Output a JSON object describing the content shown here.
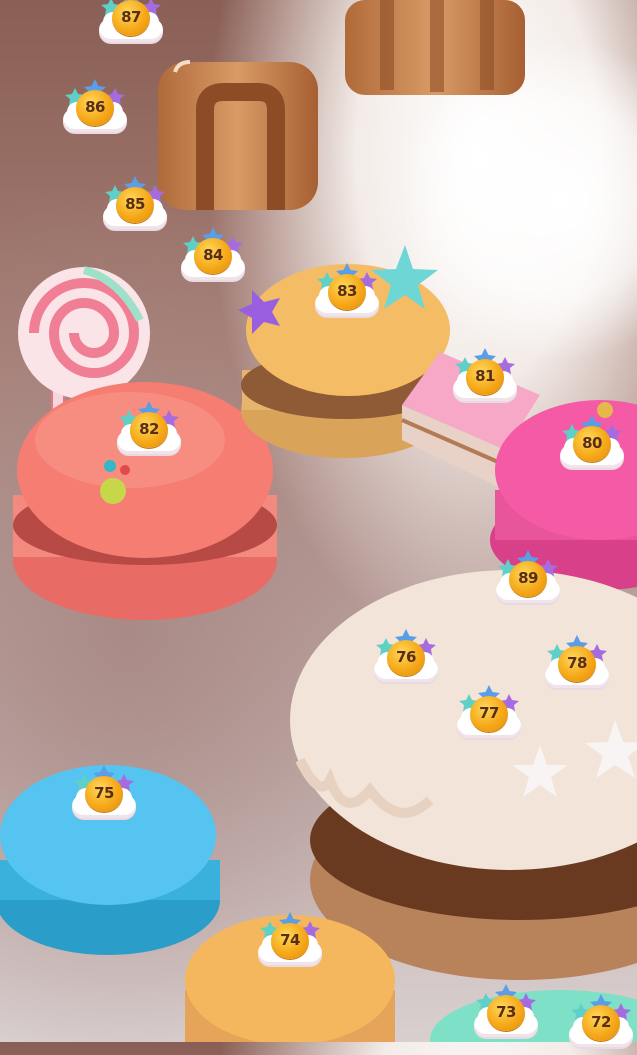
{
  "levels": [
    {
      "id": 87,
      "label": "87"
    },
    {
      "id": 86,
      "label": "86"
    },
    {
      "id": 85,
      "label": "85"
    },
    {
      "id": 84,
      "label": "84"
    },
    {
      "id": 83,
      "label": "83"
    },
    {
      "id": 82,
      "label": "82"
    },
    {
      "id": 81,
      "label": "81"
    },
    {
      "id": 80,
      "label": "80"
    },
    {
      "id": 89,
      "label": "89"
    },
    {
      "id": 78,
      "label": "78"
    },
    {
      "id": 76,
      "label": "76"
    },
    {
      "id": 77,
      "label": "77"
    },
    {
      "id": 75,
      "label": "75"
    },
    {
      "id": 74,
      "label": "74"
    },
    {
      "id": 73,
      "label": "73"
    },
    {
      "id": 72,
      "label": "72"
    }
  ],
  "colors": {
    "background": "#a67f76",
    "coin": "#f5a818",
    "star_teal": "#5fd0c8",
    "star_blue": "#5a9de8",
    "star_purple": "#a56be0",
    "macaron_orange": "#f2b460",
    "macaron_coral": "#f27a6e",
    "macaron_pink": "#f0529a",
    "macaron_blue": "#4cb8ea",
    "macaron_mint": "#64d6b8",
    "cake_cream": "#f3e6da",
    "caramel": "#c98a52"
  }
}
